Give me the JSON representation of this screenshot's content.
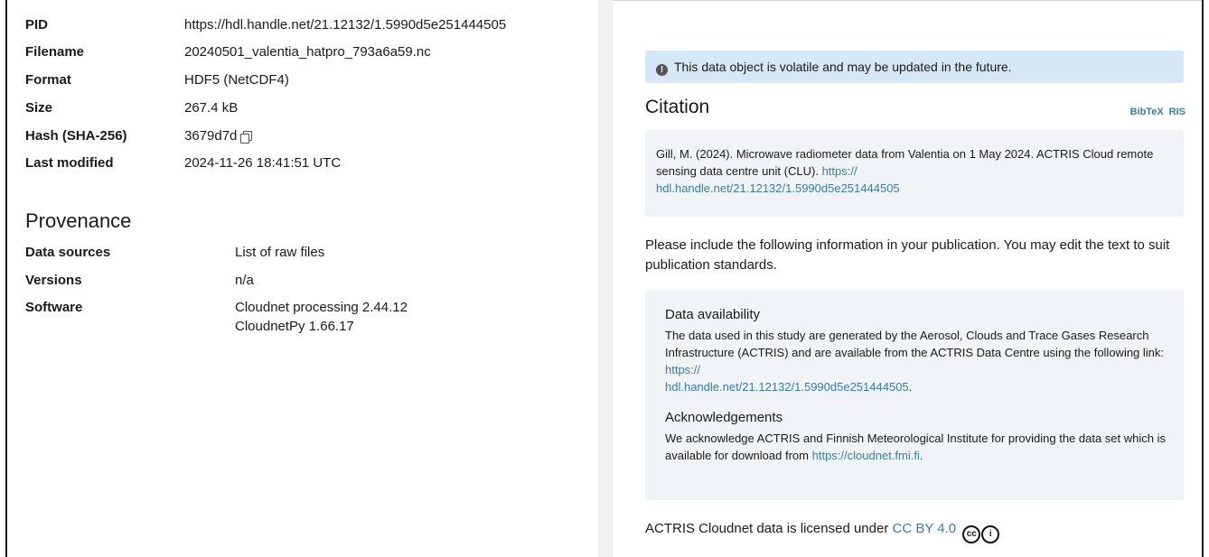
{
  "metadata": {
    "rows": [
      {
        "key": "PID",
        "value": "https://hdl.handle.net/21.12132/1.5990d5e251444505"
      },
      {
        "key": "Filename",
        "value": "20240501_valentia_hatpro_793a6a59.nc"
      },
      {
        "key": "Format",
        "value": "HDF5 (NetCDF4)"
      },
      {
        "key": "Size",
        "value": "267.4 kB"
      },
      {
        "key": "Hash (SHA-256)",
        "value": "3679d7d"
      },
      {
        "key": "Last modified",
        "value": "2024-11-26 18:41:51 UTC"
      }
    ]
  },
  "provenance": {
    "title": "Provenance",
    "data_sources_label": "Data sources",
    "data_sources_link": "List of raw files",
    "versions_label": "Versions",
    "versions_value": "n/a",
    "software_label": "Software",
    "software_items": [
      "Cloudnet processing 2.44.12",
      "CloudnetPy 1.66.17"
    ]
  },
  "notice": {
    "icon": "info-icon",
    "text": "This data object is volatile and may be updated in the future."
  },
  "citation": {
    "title": "Citation",
    "formats": [
      "BibTeX",
      "RIS"
    ],
    "text": "Gill, M. (2024). Microwave radiometer data from Valentia on 1 May 2024. ACTRIS Cloud remote sensing data centre unit (CLU).",
    "link_line1": "https://",
    "link_line2": "hdl.handle.net/21.12132/1.5990d5e251444505"
  },
  "include_text": "Please include the following information in your publication. You may edit the text to suit publication standards.",
  "data_availability": {
    "title": "Data availability",
    "text": "The data used in this study are generated by the Aerosol, Clouds and Trace Gases Research Infrastructure (ACTRIS) and are available from the ACTRIS Data Centre using the following link:",
    "link_line1": "https://",
    "link_line2": "hdl.handle.net/21.12132/1.5990d5e251444505",
    "after_link": "."
  },
  "acknowledgements": {
    "title": "Acknowledgements",
    "text": "We acknowledge ACTRIS and Finnish Meteorological Institute for providing the data set which is available for download from",
    "link": "https://cloudnet.fmi.fi",
    "after_link": "."
  },
  "license": {
    "text": "ACTRIS Cloudnet data is licensed under",
    "link": "CC BY 4.0",
    "icons": [
      "cc-icon",
      "by-icon"
    ]
  }
}
